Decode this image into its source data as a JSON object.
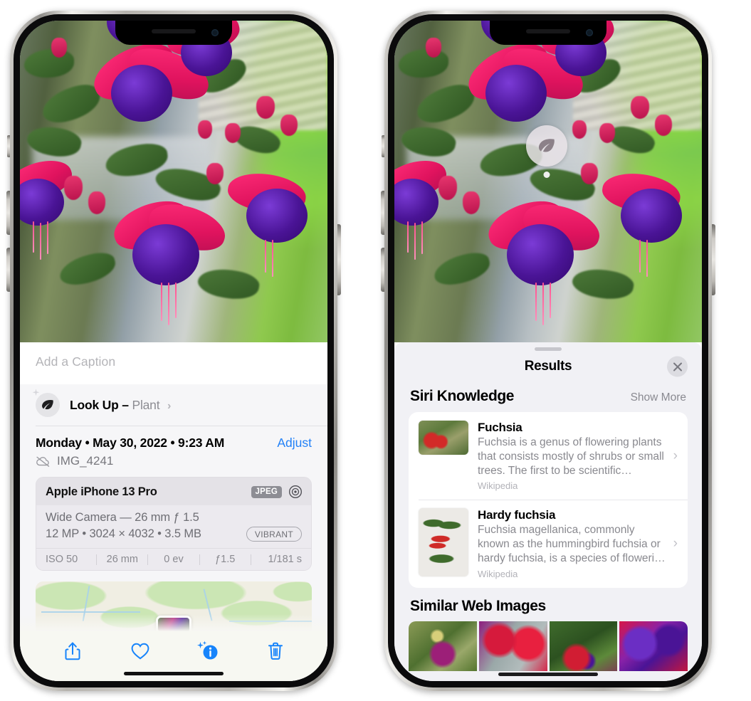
{
  "left_phone": {
    "caption_placeholder": "Add a Caption",
    "lookup": {
      "icon": "leaf-icon",
      "sparkle_icon": "sparkle-icon",
      "label": "Look Up –",
      "subject": "Plant",
      "chevron": "›"
    },
    "datetime": "Monday • May 30, 2022 • 9:23 AM",
    "adjust_label": "Adjust",
    "cloud_icon": "cloud-slash-icon",
    "filename": "IMG_4241",
    "exif": {
      "model": "Apple iPhone 13 Pro",
      "format_badge": "JPEG",
      "aperture_icon": "aperture-icon",
      "lens_line": "Wide Camera — 26 mm ƒ 1.5",
      "size_line": "12 MP • 3024 × 4032 • 3.5 MB",
      "style_badge": "VIBRANT",
      "stats": [
        "ISO 50",
        "26 mm",
        "0 ev",
        "ƒ1.5",
        "1/181 s"
      ]
    },
    "map": {
      "pin_label": "photo-pin"
    },
    "toolbar": [
      {
        "name": "share-button",
        "icon": "share-icon"
      },
      {
        "name": "favorite-button",
        "icon": "heart-icon"
      },
      {
        "name": "info-button",
        "icon": "info-sparkle-icon"
      },
      {
        "name": "delete-button",
        "icon": "trash-icon"
      }
    ]
  },
  "right_phone": {
    "leaf_badge_icon": "leaf-icon",
    "sheet_title": "Results",
    "close_icon": "close-icon",
    "siri_section": {
      "title": "Siri Knowledge",
      "show_more": "Show More",
      "cards": [
        {
          "title": "Fuchsia",
          "description": "Fuchsia is a genus of flowering plants that consists mostly of shrubs or small trees. The first to be scientific…",
          "source": "Wikipedia",
          "thumb": "fuchsia-red-flowers-thumb",
          "chevron": "›"
        },
        {
          "title": "Hardy fuchsia",
          "description": "Fuchsia magellanica, commonly known as the hummingbird fuchsia or hardy fuchsia, is a species of floweri…",
          "source": "Wikipedia",
          "thumb": "hardy-fuchsia-specimen-thumb",
          "chevron": "›"
        }
      ]
    },
    "similar_section": {
      "title": "Similar Web Images",
      "thumbs": [
        "fuchsia-magenta-leaves-thumb",
        "fuchsia-red-closeup-thumb",
        "fuchsia-bush-buds-thumb",
        "fuchsia-purple-pink-thumb"
      ]
    }
  },
  "colors": {
    "accent_blue": "#1784fb",
    "link_blue": "#2281f7",
    "sheet_bg": "#f1f1f5",
    "card_bg": "#ffffff",
    "secondary_text": "#89898f"
  }
}
